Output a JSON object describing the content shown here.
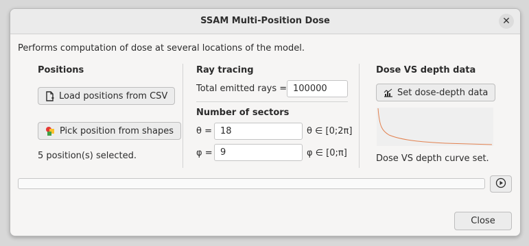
{
  "window": {
    "title": "SSAM Multi-Position Dose",
    "close_glyph": "✕"
  },
  "description": "Performs computation of dose at several locations of the model.",
  "positions": {
    "heading": "Positions",
    "load_button": {
      "label": "Load positions from CSV",
      "icon": "document-icon"
    },
    "pick_button": {
      "label": "Pick position from shapes",
      "icon": "shapes-icon"
    },
    "status": "5 position(s) selected."
  },
  "ray_tracing": {
    "heading": "Ray tracing",
    "emitted_label": "Total emitted rays =",
    "emitted_value": "100000",
    "sectors_heading": "Number of sectors",
    "theta_label": "θ =",
    "theta_value": "18",
    "theta_range": "θ ∈ [0;2π]",
    "phi_label": "φ =",
    "phi_value": "9",
    "phi_range": "φ ∈ [0;π]"
  },
  "dose_depth": {
    "heading": "Dose VS depth data",
    "button_label": "Set dose-depth data",
    "button_icon": "chart-icon",
    "status": "Dose VS depth curve set.",
    "curve_color": "#e2814f"
  },
  "progress": {
    "value": 0
  },
  "run_button": {
    "icon": "play-icon"
  },
  "footer": {
    "close_label": "Close"
  }
}
